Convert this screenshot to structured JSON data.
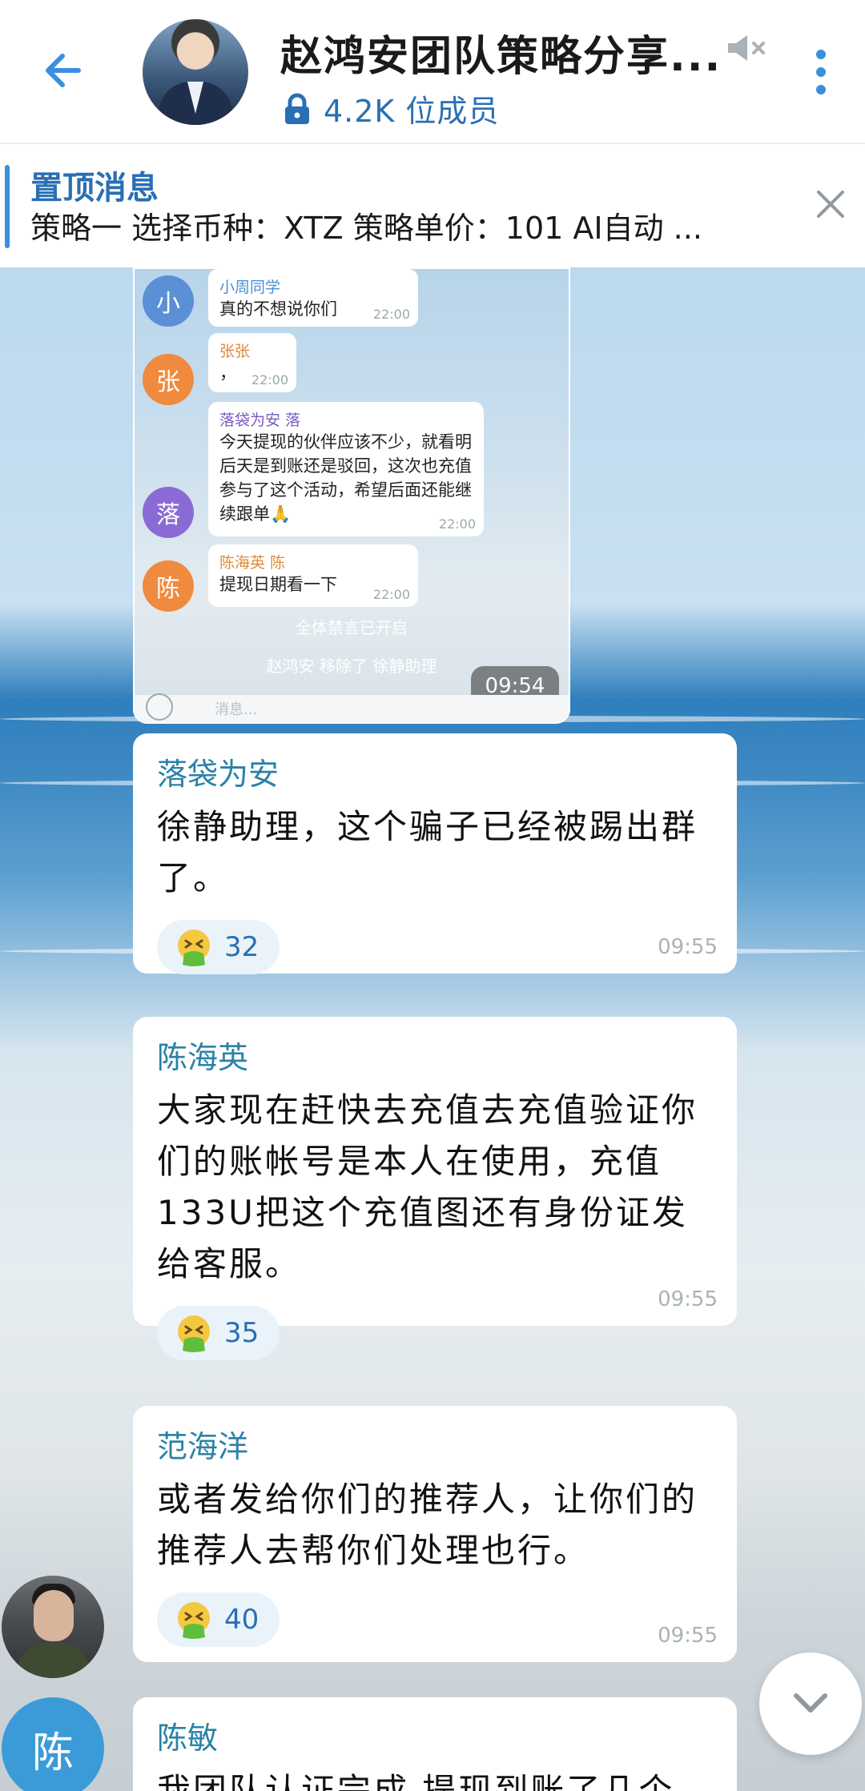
{
  "header": {
    "title": "赵鸿安团队策略分享...",
    "members": "4.2K 位成员"
  },
  "pinned": {
    "label": "置顶消息",
    "text": "策略一 选择币种：XTZ 策略单价：101 AI自动 ..."
  },
  "screenshot": {
    "messages": [
      {
        "avatar": "小",
        "name": "小周同学",
        "text": "真的不想说你们",
        "time": "22:00"
      },
      {
        "avatar": "张",
        "name": "张张",
        "text": "，",
        "time": "22:00"
      },
      {
        "avatar": "落",
        "name": "落袋为安 落",
        "text": "今天提现的伙伴应该不少，就看明后天是到账还是驳回，这次也充值参与了这个活动，希望后面还能继续跟单🙏",
        "time": "22:00"
      },
      {
        "avatar": "陈",
        "name": "陈海英 陈",
        "text": "提现日期看一下",
        "time": "22:00"
      }
    ],
    "system1": "全体禁言已开启",
    "system2": "赵鸿安 移除了 徐静助理",
    "stamp": "09:54",
    "input_placeholder": "消息..."
  },
  "messages": [
    {
      "name": "落袋为安",
      "text": "徐静助理，这个骗子已经被踢出群了。",
      "reaction": "32",
      "time": "09:55"
    },
    {
      "name": "陈海英",
      "text": "大家现在赶快去充值去充值验证你们的账帐号是本人在使用，充值133U把这个充值图还有身份证发给客服。",
      "reaction": "35",
      "time": "09:55"
    },
    {
      "name": "范海洋",
      "text": "或者发给你们的推荐人，让你们的推荐人去帮你们处理也行。",
      "reaction": "40",
      "time": "09:55"
    },
    {
      "name": "陈敏",
      "text": "我团队认证完成 提现到账了几个"
    }
  ],
  "avatars": {
    "chen": "陈"
  },
  "colors": {
    "accent": "#2a6fb3",
    "name_color": "#2a82a6",
    "avatar_blue": "#3a9bd8"
  }
}
